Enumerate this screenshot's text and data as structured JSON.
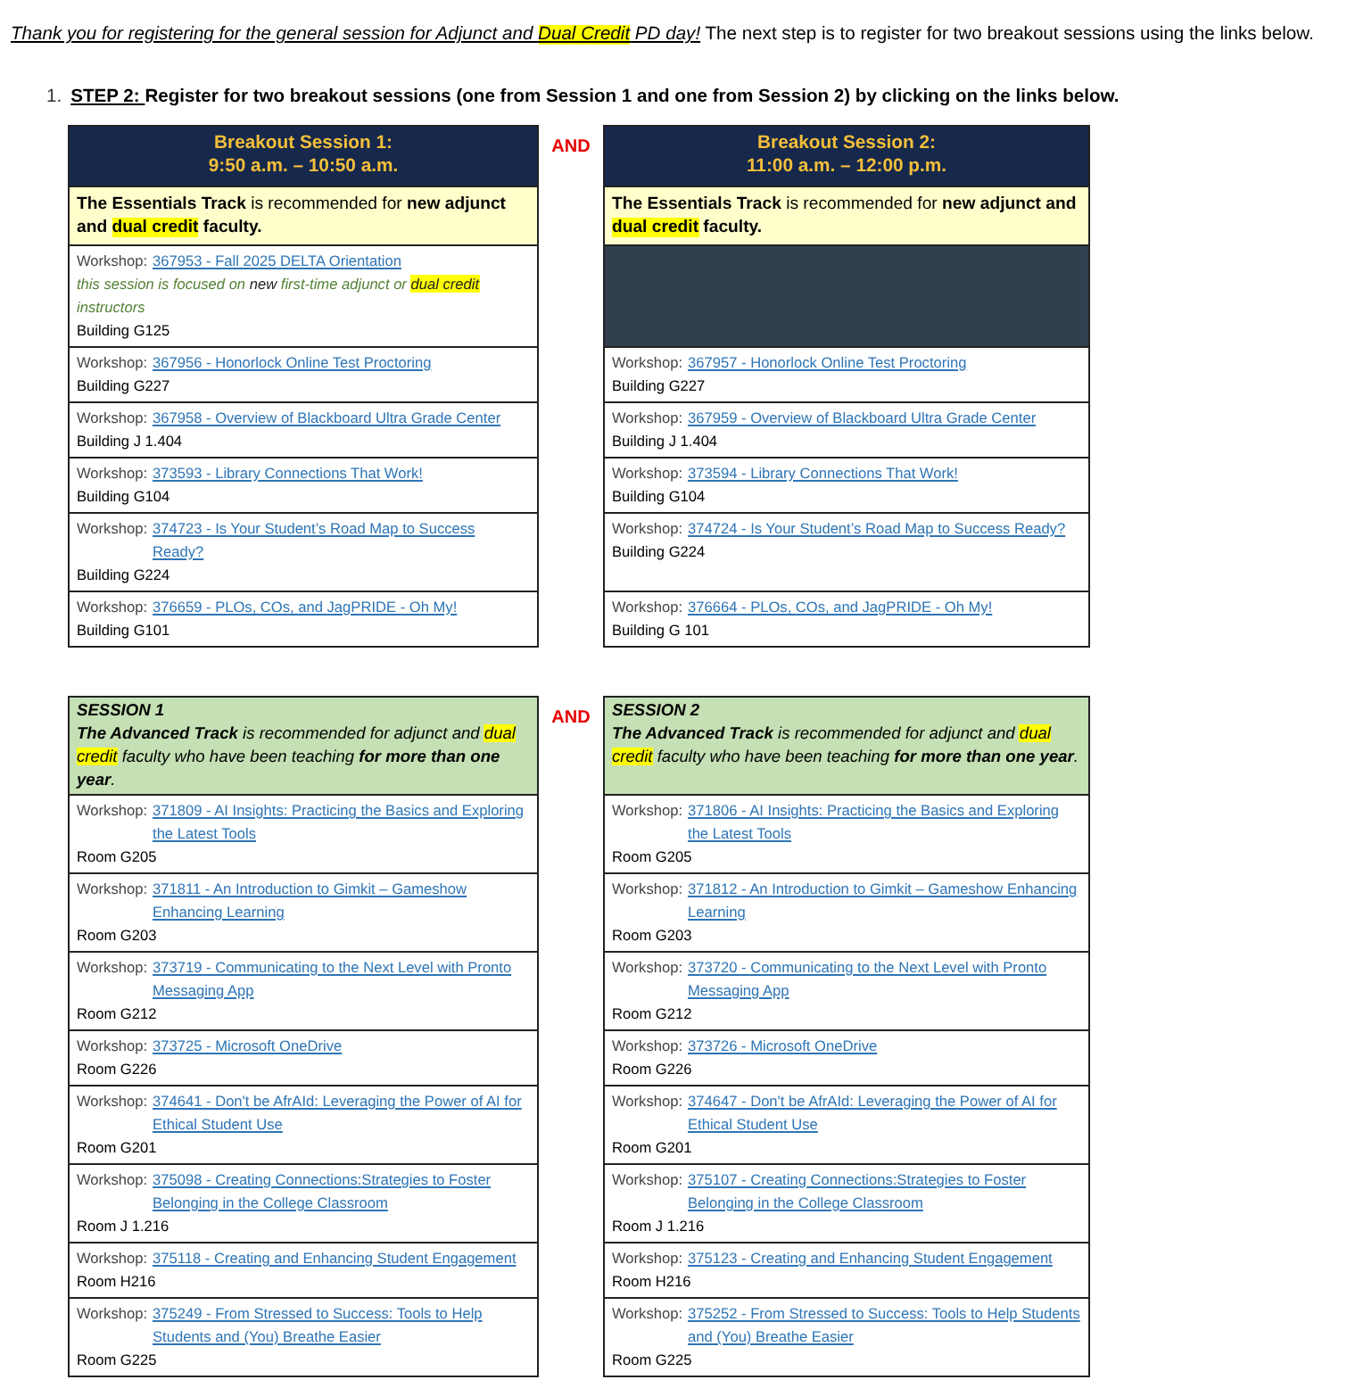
{
  "intro": [
    {
      "text": "Thank you for registering for the general session for Adjunct and ",
      "i": true,
      "u": true
    },
    {
      "text": "Dual Credit",
      "i": true,
      "u": true,
      "hl": true
    },
    {
      "text": " PD day!",
      "i": true,
      "u": true
    },
    {
      "text": "  The next step is to register for two breakout sessions using the links below."
    }
  ],
  "step": {
    "number": "1.",
    "runs": [
      {
        "text": "STEP 2: ",
        "u": true
      },
      {
        "text": "Register for two breakout sessions (one from Session 1 and one from Session 2) by clicking on the links below."
      }
    ]
  },
  "sections": [
    {
      "kind": "essentials",
      "connector": "AND",
      "columns": [
        {
          "title": "Breakout Session 1:",
          "time": "9:50 a.m. – 10:50 a.m.",
          "description": [
            {
              "text": "The Essentials Track",
              "b": true
            },
            {
              "text": " is recommended for "
            },
            {
              "text": "new adjunct and ",
              "b": true
            },
            {
              "text": "dual credit",
              "b": true,
              "hl": true
            },
            {
              "text": " faculty.",
              "b": true
            }
          ],
          "rows": [
            {
              "kind": "workshop",
              "label": "Workshop:",
              "link": "367953 - Fall 2025 DELTA Orientation",
              "note": [
                {
                  "text": "this session is focused on "
                },
                {
                  "text": "new",
                  "plain": true
                },
                {
                  "text": " first-time adjunct or "
                },
                {
                  "text": "dual credit",
                  "plain": true,
                  "hl": true
                },
                {
                  "text": " instructors"
                }
              ],
              "location": "Building G125"
            },
            {
              "kind": "workshop",
              "label": "Workshop:",
              "link": "367956 - Honorlock Online Test Proctoring",
              "location": "Building G227"
            },
            {
              "kind": "workshop",
              "label": "Workshop:",
              "link": "367958 - Overview of Blackboard Ultra Grade Center",
              "location": "Building J 1.404"
            },
            {
              "kind": "workshop",
              "label": "Workshop:",
              "link": "373593 - Library Connections That Work!",
              "location": "Building G104"
            },
            {
              "kind": "workshop",
              "label": "Workshop:",
              "link": "374723 - Is Your Student’s Road Map to Success Ready?",
              "location": "Building G224"
            },
            {
              "kind": "workshop",
              "label": "Workshop:",
              "link": "376659 - PLOs, COs, and JagPRIDE - Oh My!",
              "location": "Building G101"
            }
          ]
        },
        {
          "title": "Breakout Session 2:",
          "time": "11:00 a.m. – 12:00 p.m.",
          "description": [
            {
              "text": "The Essentials Track",
              "b": true
            },
            {
              "text": " is recommended for "
            },
            {
              "text": "new adjunct and ",
              "b": true
            },
            {
              "text": "dual credit",
              "b": true,
              "hl": true
            },
            {
              "text": " faculty.",
              "b": true
            }
          ],
          "rows": [
            {
              "kind": "blank"
            },
            {
              "kind": "workshop",
              "label": "Workshop:",
              "link": "367957 - Honorlock Online Test Proctoring",
              "location": "Building G227"
            },
            {
              "kind": "workshop",
              "label": "Workshop:",
              "link": "367959 - Overview of Blackboard Ultra Grade Center",
              "location": "Building J 1.404"
            },
            {
              "kind": "workshop",
              "label": "Workshop:",
              "link": "373594 - Library Connections That Work!",
              "location": "Building G104"
            },
            {
              "kind": "workshop",
              "label": "Workshop:",
              "link": "374724 - Is Your Student’s Road Map to Success Ready?",
              "location": "Building G224"
            },
            {
              "kind": "workshop",
              "label": "Workshop:",
              "link": "376664 - PLOs, COs, and JagPRIDE - Oh My!",
              "location": "Building G 101"
            }
          ]
        }
      ]
    },
    {
      "kind": "advanced",
      "connector": "AND",
      "columns": [
        {
          "title": "SESSION 1",
          "description": [
            {
              "text": "The Advanced Track",
              "b": true
            },
            {
              "text": " is recommended for adjunct and "
            },
            {
              "text": "dual credit",
              "hl": true
            },
            {
              "text": " faculty who have been teaching "
            },
            {
              "text": "for more than one year",
              "b": true
            },
            {
              "text": "."
            }
          ],
          "rows": [
            {
              "kind": "workshop",
              "label": "Workshop:",
              "link": "371809 - AI Insights: Practicing the Basics and Exploring the Latest Tools",
              "location": "Room G205"
            },
            {
              "kind": "workshop",
              "label": "Workshop:",
              "link": "371811 - An Introduction to Gimkit – Gameshow Enhancing Learning",
              "location": "Room G203"
            },
            {
              "kind": "workshop",
              "label": "Workshop:",
              "link": "373719 - Communicating to the Next Level with Pronto Messaging App",
              "location": "Room G212"
            },
            {
              "kind": "workshop",
              "label": "Workshop:",
              "link": "373725 - Microsoft OneDrive",
              "location": "Room G226"
            },
            {
              "kind": "workshop",
              "label": "Workshop:",
              "link": "374641 - Don't be AfrAId: Leveraging the Power of AI for Ethical Student Use",
              "location": "Room G201"
            },
            {
              "kind": "workshop",
              "label": "Workshop:",
              "link": "375098 - Creating Connections:Strategies to Foster Belonging in the College Classroom",
              "location": "Room J 1.216"
            },
            {
              "kind": "workshop",
              "label": "Workshop:",
              "link": "375118 - Creating and Enhancing Student Engagement",
              "location": "Room H216"
            },
            {
              "kind": "workshop",
              "label": "Workshop:",
              "link": "375249 - From Stressed to Success: Tools to Help Students and (You) Breathe Easier",
              "location": "Room G225"
            }
          ]
        },
        {
          "title": "SESSION 2",
          "description": [
            {
              "text": "The Advanced Track",
              "b": true
            },
            {
              "text": " is recommended for adjunct and "
            },
            {
              "text": "dual credit",
              "hl": true
            },
            {
              "text": " faculty who have been teaching "
            },
            {
              "text": "for more than one year",
              "b": true
            },
            {
              "text": "."
            }
          ],
          "rows": [
            {
              "kind": "workshop",
              "label": "Workshop:",
              "link": "371806 - AI Insights: Practicing the Basics and Exploring the Latest Tools",
              "location": "Room G205"
            },
            {
              "kind": "workshop",
              "label": "Workshop:",
              "link": "371812 - An Introduction to Gimkit – Gameshow Enhancing Learning",
              "location": "Room G203"
            },
            {
              "kind": "workshop",
              "label": "Workshop:",
              "link": "373720 - Communicating to the Next Level with Pronto Messaging App",
              "location": "Room G212"
            },
            {
              "kind": "workshop",
              "label": "Workshop:",
              "link": "373726 - Microsoft OneDrive",
              "location": "Room G226"
            },
            {
              "kind": "workshop",
              "label": "Workshop:",
              "link": "374647 - Don't be AfrAId: Leveraging the Power of AI for Ethical Student Use",
              "location": "Room G201"
            },
            {
              "kind": "workshop",
              "label": "Workshop:",
              "link": "375107 - Creating Connections:Strategies to Foster Belonging in the College Classroom",
              "location": "Room J 1.216"
            },
            {
              "kind": "workshop",
              "label": "Workshop:",
              "link": "375123 - Creating and Enhancing Student Engagement",
              "location": "Room H216"
            },
            {
              "kind": "workshop",
              "label": "Workshop:",
              "link": "375252 - From Stressed to Success: Tools to Help Students and (You) Breathe Easier",
              "location": "Room G225"
            }
          ]
        }
      ]
    }
  ]
}
